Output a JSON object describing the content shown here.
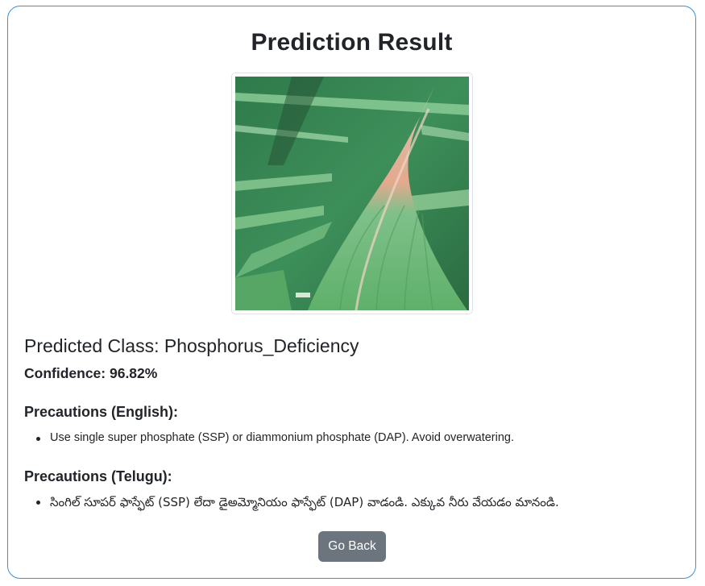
{
  "page": {
    "title": "Prediction Result"
  },
  "image": {
    "content": "leaf photo"
  },
  "result": {
    "predicted_class_label": "Predicted Class: Phosphorus_Deficiency",
    "confidence_label": "Confidence: 96.82%"
  },
  "precautions": {
    "english_heading": "Precautions (English):",
    "english_items": [
      "Use single super phosphate (SSP) or diammonium phosphate (DAP). Avoid overwatering."
    ],
    "telugu_heading": "Precautions (Telugu):",
    "telugu_items": [
      "సింగిల్ సూపర్ ఫాస్ఫేట్ (SSP) లేదా డైఅమ్మోనియం ఫాస్ఫేట్ (DAP) వాడండి. ఎక్కువ నీరు వేయడం మానండి."
    ]
  },
  "actions": {
    "go_back_label": "Go Back"
  },
  "colors": {
    "card_border": "#3b8fd6",
    "button_bg": "#6c757d",
    "text": "#212529"
  }
}
